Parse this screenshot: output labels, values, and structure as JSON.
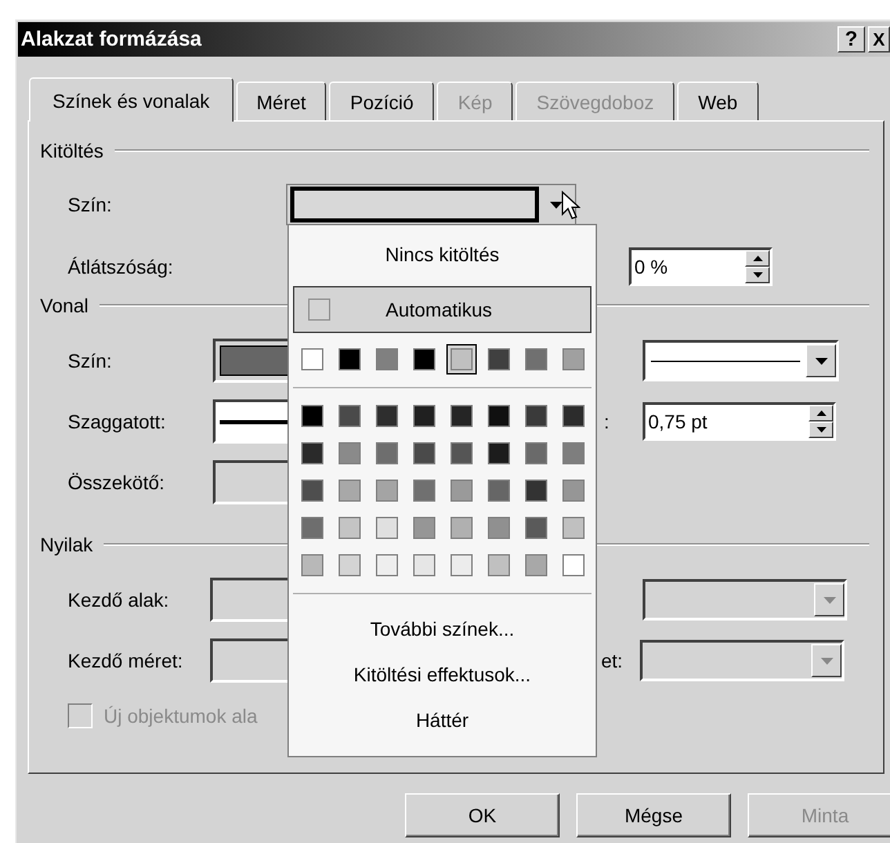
{
  "window": {
    "title": "Alakzat formázása",
    "buttons": [
      {
        "kind": "help",
        "label": "?"
      },
      {
        "kind": "close",
        "label": "X"
      }
    ]
  },
  "tabs": [
    {
      "label": "Színek és vonalak",
      "selected": true,
      "disabled": false
    },
    {
      "label": "Méret",
      "selected": false,
      "disabled": false
    },
    {
      "label": "Pozíció",
      "selected": false,
      "disabled": false
    },
    {
      "label": "Kép",
      "selected": false,
      "disabled": true
    },
    {
      "label": "Szövegdoboz",
      "selected": false,
      "disabled": true
    },
    {
      "label": "Web",
      "selected": false,
      "disabled": false
    }
  ],
  "fill": {
    "heading": "Kitöltés",
    "color_label": "Szín:",
    "transparency_label": "Átlátszóság:",
    "transparency": "0 %"
  },
  "line": {
    "heading": "Vonal",
    "color_label": "Szín:",
    "dash_label": "Szaggatott:",
    "connector_label": "Összekötő:",
    "weight_label": ":",
    "weight": "0,75 pt"
  },
  "arrows": {
    "heading": "Nyilak",
    "begin_style_label": "Kezdő alak:",
    "begin_size_label": "Kezdő méret:",
    "end_size_label": "et:"
  },
  "default_checkbox": {
    "label": "Új objektumok ala",
    "checked": false,
    "disabled": true
  },
  "color_menu": {
    "no_fill": "Nincs kitöltés",
    "automatic": "Automatikus",
    "standard_colors": [
      {
        "color": "#ffffff",
        "selected": false
      },
      {
        "color": "#000000",
        "selected": false
      },
      {
        "color": "#808080",
        "selected": false
      },
      {
        "color": "#000000",
        "selected": false
      },
      {
        "color": "#c0c0c0",
        "selected": true
      },
      {
        "color": "#404040",
        "selected": false
      },
      {
        "color": "#707070",
        "selected": false
      },
      {
        "color": "#a0a0a0",
        "selected": false
      }
    ],
    "palette": [
      [
        {
          "color": "#000000",
          "selected": false
        },
        {
          "color": "#4a4a4a",
          "selected": false
        },
        {
          "color": "#2e2e2e",
          "selected": false
        },
        {
          "color": "#202020",
          "selected": false
        },
        {
          "color": "#252525",
          "selected": false
        },
        {
          "color": "#101010",
          "selected": false
        },
        {
          "color": "#3a3a3a",
          "selected": false
        },
        {
          "color": "#2c2c2c",
          "selected": false
        }
      ],
      [
        {
          "color": "#2a2a2a",
          "selected": false
        },
        {
          "color": "#8a8a8a",
          "selected": false
        },
        {
          "color": "#6e6e6e",
          "selected": false
        },
        {
          "color": "#4a4a4a",
          "selected": false
        },
        {
          "color": "#555555",
          "selected": false
        },
        {
          "color": "#1c1c1c",
          "selected": false
        },
        {
          "color": "#6a6a6a",
          "selected": false
        },
        {
          "color": "#7e7e7e",
          "selected": false
        }
      ],
      [
        {
          "color": "#4e4e4e",
          "selected": false
        },
        {
          "color": "#a8a8a8",
          "selected": false
        },
        {
          "color": "#a4a4a4",
          "selected": false
        },
        {
          "color": "#707070",
          "selected": false
        },
        {
          "color": "#9a9a9a",
          "selected": false
        },
        {
          "color": "#666666",
          "selected": false
        },
        {
          "color": "#333333",
          "selected": false
        },
        {
          "color": "#969696",
          "selected": false
        }
      ],
      [
        {
          "color": "#6e6e6e",
          "selected": false
        },
        {
          "color": "#c4c4c4",
          "selected": false
        },
        {
          "color": "#e0e0e0",
          "selected": false
        },
        {
          "color": "#969696",
          "selected": false
        },
        {
          "color": "#b0b0b0",
          "selected": false
        },
        {
          "color": "#909090",
          "selected": false
        },
        {
          "color": "#5a5a5a",
          "selected": false
        },
        {
          "color": "#c0c0c0",
          "selected": false
        }
      ],
      [
        {
          "color": "#b8b8b8",
          "selected": false
        },
        {
          "color": "#d4d4d4",
          "selected": false
        },
        {
          "color": "#eeeeee",
          "selected": false
        },
        {
          "color": "#e6e6e6",
          "selected": false
        },
        {
          "color": "#ececec",
          "selected": false
        },
        {
          "color": "#c0c0c0",
          "selected": false
        },
        {
          "color": "#a8a8a8",
          "selected": false
        },
        {
          "color": "#ffffff",
          "selected": false
        }
      ]
    ],
    "more_colors": "További színek...",
    "fill_effects": "Kitöltési effektusok...",
    "background": "Háttér"
  },
  "buttons": [
    {
      "label": "OK",
      "disabled": false
    },
    {
      "label": "Mégse",
      "disabled": false
    },
    {
      "label": "Minta",
      "disabled": true
    }
  ]
}
